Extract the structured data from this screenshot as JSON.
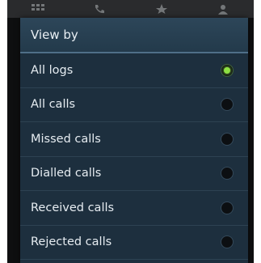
{
  "dialog": {
    "title": "View by"
  },
  "options": [
    {
      "label": "All logs",
      "selected": true
    },
    {
      "label": "All calls",
      "selected": false
    },
    {
      "label": "Missed calls",
      "selected": false
    },
    {
      "label": "Dialled calls",
      "selected": false
    },
    {
      "label": "Received calls",
      "selected": false
    },
    {
      "label": "Rejected calls",
      "selected": false
    }
  ],
  "icons": [
    "keypad-icon",
    "phone-icon",
    "star-icon",
    "contacts-icon"
  ],
  "colors": {
    "dialog_bg": "#1d2f3e",
    "header_bg": "#2d4659",
    "selected_radio": "#8ee043"
  }
}
